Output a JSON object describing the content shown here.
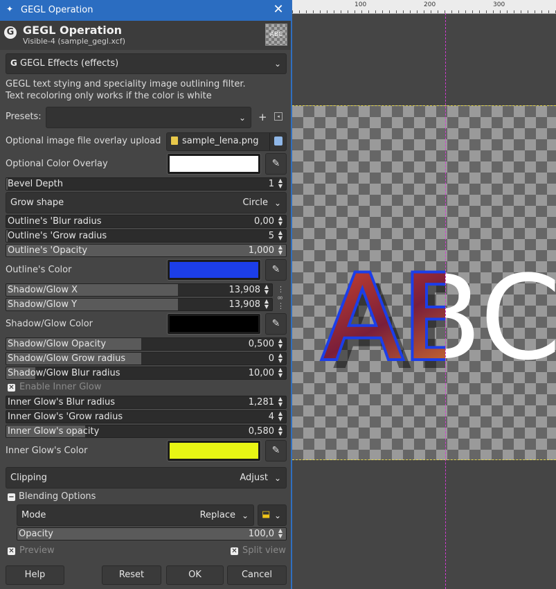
{
  "window": {
    "title": "GEGL Operation"
  },
  "header": {
    "title": "GEGL Operation",
    "subtitle": "Visible-4 (sample_gegl.xcf)",
    "thumbnail_text": "ABC"
  },
  "operation": {
    "selected": "GEGL Effects (effects)"
  },
  "description": {
    "line1": "GEGL text stying and speciality image outlining filter.",
    "line2": "Text recoloring only works if the color is white"
  },
  "presets": {
    "label": "Presets:",
    "value": ""
  },
  "overlay_file": {
    "label": "Optional image file overlay upload",
    "filename": "sample_lena.png"
  },
  "color_overlay": {
    "label": "Optional Color Overlay",
    "color": "#ffffff"
  },
  "bevel_depth": {
    "label": "Bevel Depth",
    "value": "1"
  },
  "grow_shape": {
    "label": "Grow shape",
    "value": "Circle"
  },
  "outline_blur": {
    "label": "Outline's 'Blur radius",
    "value": "0,00"
  },
  "outline_grow": {
    "label": "Outline's 'Grow radius",
    "value": "5"
  },
  "outline_opacity": {
    "label": "Outline's 'Opacity",
    "value": "1,000"
  },
  "outline_color": {
    "label": "Outline's Color",
    "color": "#1c3ee8"
  },
  "shadow_x": {
    "label": "Shadow/Glow X",
    "value": "13,908"
  },
  "shadow_y": {
    "label": "Shadow/Glow Y",
    "value": "13,908"
  },
  "shadow_color": {
    "label": "Shadow/Glow Color",
    "color": "#000000"
  },
  "shadow_opacity": {
    "label": "Shadow/Glow Opacity",
    "value": "0,500"
  },
  "shadow_grow": {
    "label": "Shadow/Glow Grow radius",
    "value": "0"
  },
  "shadow_blur": {
    "label": "Shadow/Glow Blur radius",
    "value": "10,00"
  },
  "inner_glow_enable": {
    "label": "Enable Inner Glow"
  },
  "inner_glow_blur": {
    "label": "Inner Glow's Blur radius",
    "value": "1,281"
  },
  "inner_glow_grow": {
    "label": "Inner Glow's 'Grow radius",
    "value": "4"
  },
  "inner_glow_opacity": {
    "label": "Inner Glow's opacity",
    "value": "0,580"
  },
  "inner_glow_color": {
    "label": "Inner Glow's Color",
    "color": "#e8f514"
  },
  "clipping": {
    "label": "Clipping",
    "value": "Adjust"
  },
  "blending": {
    "label": "Blending Options",
    "mode_label": "Mode",
    "mode_value": "Replace",
    "opacity_label": "Opacity",
    "opacity_value": "100,0"
  },
  "preview": {
    "label": "Preview"
  },
  "split_view": {
    "label": "Split view"
  },
  "buttons": {
    "help": "Help",
    "reset": "Reset",
    "ok": "OK",
    "cancel": "Cancel"
  },
  "ruler": {
    "labels": [
      "100",
      "200",
      "300"
    ]
  },
  "canvas": {
    "text": "ABC"
  },
  "colors": {
    "accent": "#2b6dc1",
    "guide": "#d23cd2"
  }
}
